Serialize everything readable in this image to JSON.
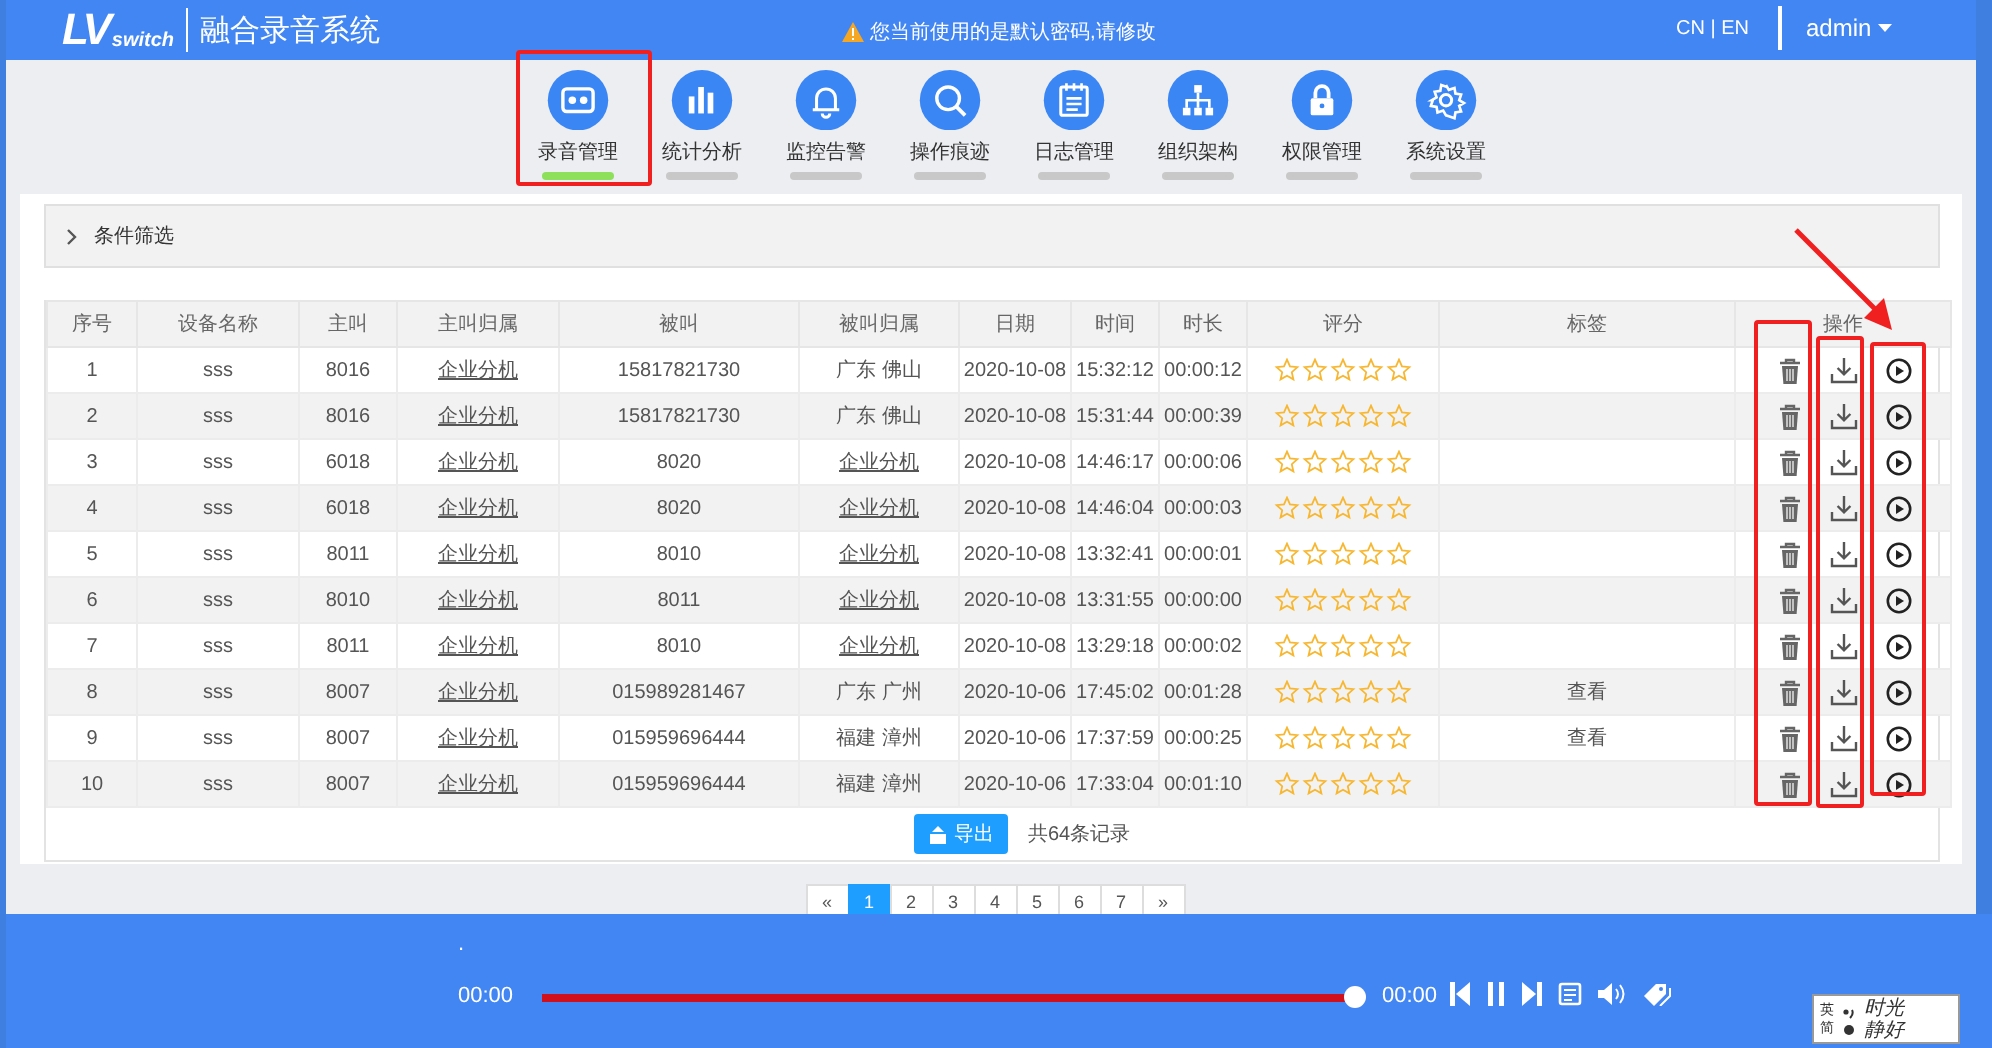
{
  "header": {
    "logo_mark": "LV",
    "logo_sub": "switch",
    "title": "融合录音系统",
    "warning": "您当前使用的是默认密码,请修改",
    "language": "CN | EN",
    "user": "admin"
  },
  "nav": [
    {
      "label": "录音管理",
      "kind": "tape",
      "selected": true
    },
    {
      "label": "统计分析",
      "kind": "chart",
      "selected": false
    },
    {
      "label": "监控告警",
      "kind": "bell",
      "selected": false
    },
    {
      "label": "操作痕迹",
      "kind": "search",
      "selected": false
    },
    {
      "label": "日志管理",
      "kind": "notes",
      "selected": false
    },
    {
      "label": "组织架构",
      "kind": "org",
      "selected": false
    },
    {
      "label": "权限管理",
      "kind": "lock",
      "selected": false
    },
    {
      "label": "系统设置",
      "kind": "gear",
      "selected": false
    }
  ],
  "filter": {
    "label": "条件筛选",
    "expanded": false
  },
  "table": {
    "columns": [
      "序号",
      "设备名称",
      "主叫",
      "主叫归属",
      "被叫",
      "被叫归属",
      "日期",
      "时间",
      "时长",
      "评分",
      "标签",
      "操作"
    ],
    "rows": [
      {
        "no": "1",
        "device": "sss",
        "caller": "8016",
        "caller_area": "企业分机",
        "callee": "15817821730",
        "callee_area": "广东 佛山",
        "callee_area_link": false,
        "date": "2020-10-08",
        "time": "15:32:12",
        "duration": "00:00:12",
        "stars": 0
      },
      {
        "no": "2",
        "device": "sss",
        "caller": "8016",
        "caller_area": "企业分机",
        "callee": "15817821730",
        "callee_area": "广东 佛山",
        "callee_area_link": false,
        "date": "2020-10-08",
        "time": "15:31:44",
        "duration": "00:00:39",
        "stars": 0
      },
      {
        "no": "3",
        "device": "sss",
        "caller": "6018",
        "caller_area": "企业分机",
        "callee": "8020",
        "callee_area": "企业分机",
        "callee_area_link": true,
        "date": "2020-10-08",
        "time": "14:46:17",
        "duration": "00:00:06",
        "stars": 0
      },
      {
        "no": "4",
        "device": "sss",
        "caller": "6018",
        "caller_area": "企业分机",
        "callee": "8020",
        "callee_area": "企业分机",
        "callee_area_link": true,
        "date": "2020-10-08",
        "time": "14:46:04",
        "duration": "00:00:03",
        "stars": 0
      },
      {
        "no": "5",
        "device": "sss",
        "caller": "8011",
        "caller_area": "企业分机",
        "callee": "8010",
        "callee_area": "企业分机",
        "callee_area_link": true,
        "date": "2020-10-08",
        "time": "13:32:41",
        "duration": "00:00:01",
        "stars": 0
      },
      {
        "no": "6",
        "device": "sss",
        "caller": "8010",
        "caller_area": "企业分机",
        "callee": "8011",
        "callee_area": "企业分机",
        "callee_area_link": true,
        "date": "2020-10-08",
        "time": "13:31:55",
        "duration": "00:00:00",
        "stars": 0
      },
      {
        "no": "7",
        "device": "sss",
        "caller": "8011",
        "caller_area": "企业分机",
        "callee": "8010",
        "callee_area": "企业分机",
        "callee_area_link": true,
        "date": "2020-10-08",
        "time": "13:29:18",
        "duration": "00:00:02",
        "stars": 0
      },
      {
        "no": "8",
        "device": "sss",
        "caller": "8007",
        "caller_area": "企业分机",
        "callee": "015989281467",
        "callee_area": "广东 广州",
        "callee_area_link": false,
        "date": "2020-10-06",
        "time": "17:45:02",
        "duration": "00:01:28",
        "stars": 0,
        "tag": "查看"
      },
      {
        "no": "9",
        "device": "sss",
        "caller": "8007",
        "caller_area": "企业分机",
        "callee": "015959696444",
        "callee_area": "福建 漳州",
        "callee_area_link": false,
        "date": "2020-10-06",
        "time": "17:37:59",
        "duration": "00:00:25",
        "stars": 0,
        "tag": "查看"
      },
      {
        "no": "10",
        "device": "sss",
        "caller": "8007",
        "caller_area": "企业分机",
        "callee": "015959696444",
        "callee_area": "福建 漳州",
        "callee_area_link": false,
        "date": "2020-10-06",
        "time": "17:33:04",
        "duration": "00:01:10",
        "stars": 0
      }
    ]
  },
  "export_button": "导出",
  "total": "共64条记录",
  "pagination": [
    {
      "label": "«",
      "selected": false
    },
    {
      "label": "1",
      "selected": true
    },
    {
      "label": "2",
      "selected": false
    },
    {
      "label": "3",
      "selected": false
    },
    {
      "label": "4",
      "selected": false
    },
    {
      "label": "5",
      "selected": false
    },
    {
      "label": "6",
      "selected": false
    },
    {
      "label": "7",
      "selected": false
    },
    {
      "label": "»",
      "selected": false
    }
  ],
  "player": {
    "track": ".",
    "current": "00:00",
    "total": "00:00",
    "level": 1
  },
  "ime": {
    "mode": "英",
    "script": "简",
    "phrase_1": "时光",
    "phrase_2": "静好"
  }
}
